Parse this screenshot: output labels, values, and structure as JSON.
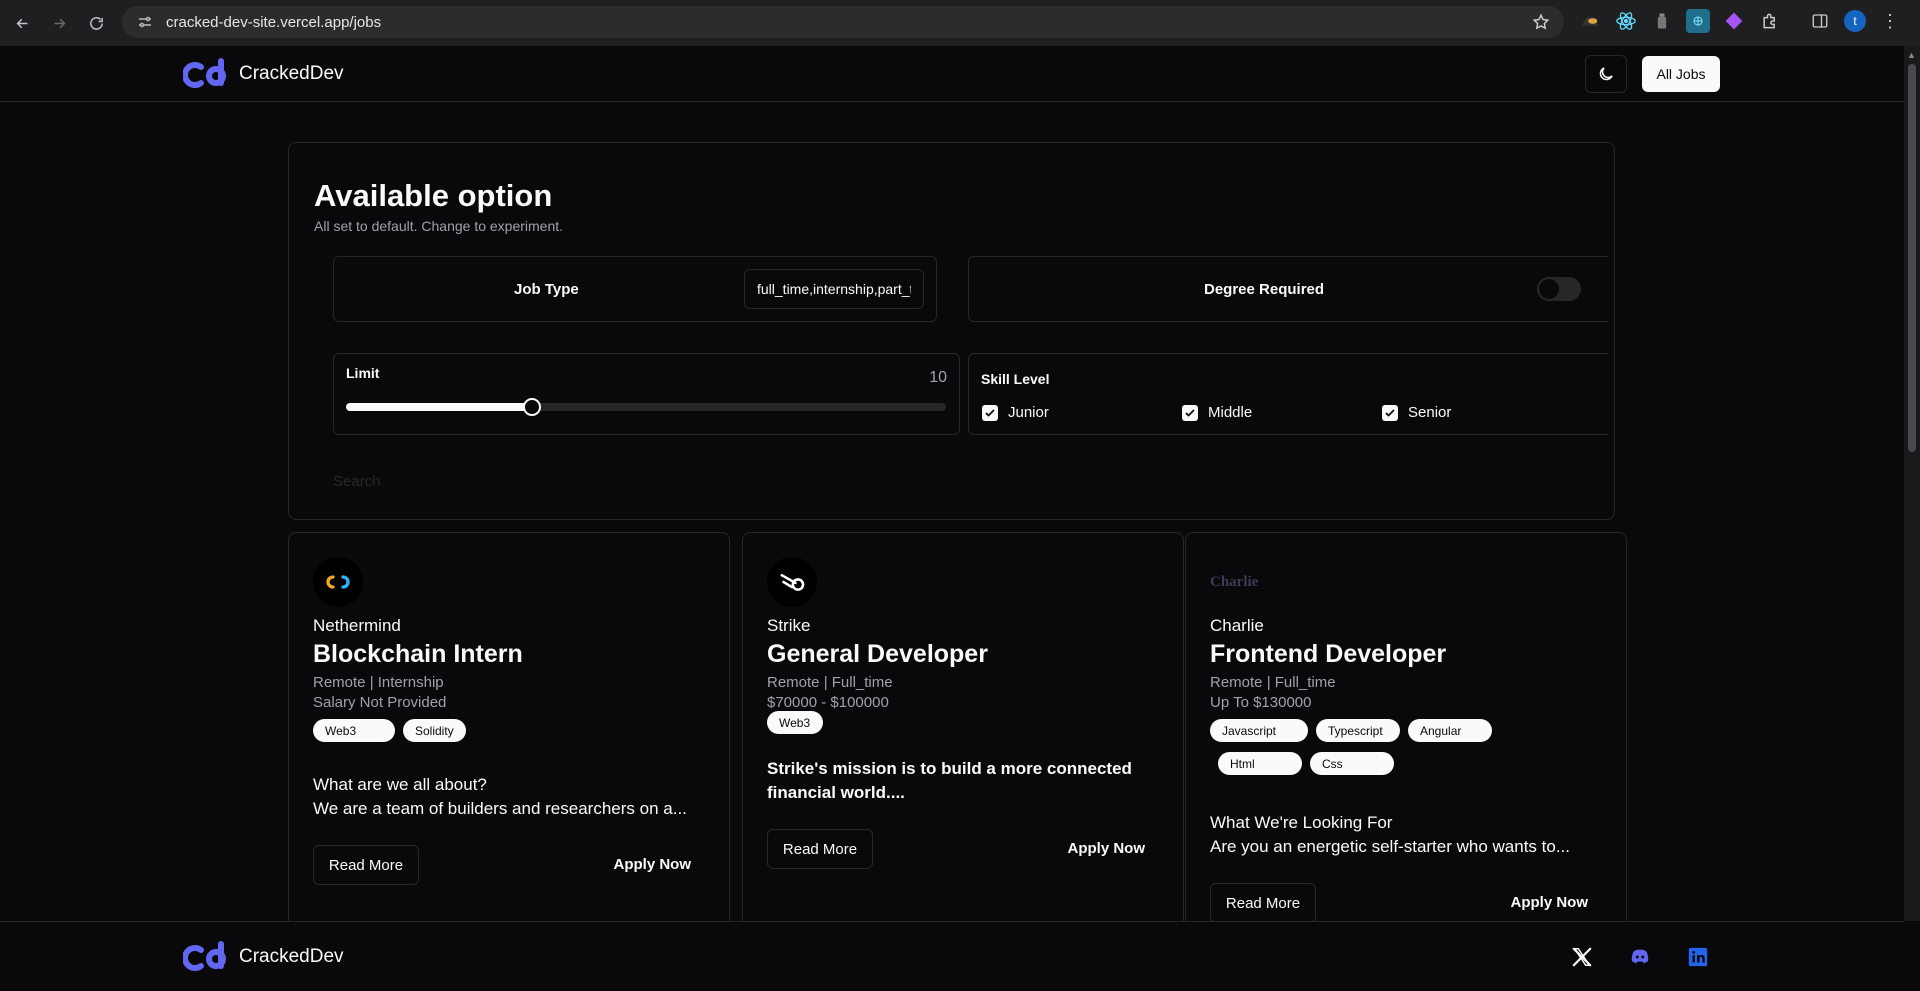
{
  "browser": {
    "url": "cracked-dev-site.vercel.app/jobs",
    "profile_initial": "t"
  },
  "header": {
    "logo_text": "CrackedDev",
    "all_jobs_label": "All Jobs"
  },
  "options": {
    "title": "Available option",
    "subtitle": "All set to default. Change to experiment.",
    "job_type_label": "Job Type",
    "job_type_value": "full_time,internship,part_time",
    "degree_label": "Degree Required",
    "degree_required": false,
    "limit_label": "Limit",
    "limit_value": "10",
    "limit_fraction": 0.31,
    "skill_label": "Skill Level",
    "skills": [
      {
        "label": "Junior",
        "checked": true
      },
      {
        "label": "Middle",
        "checked": true
      },
      {
        "label": "Senior",
        "checked": true
      }
    ],
    "search_placeholder": "Search"
  },
  "jobs": [
    {
      "company": "Nethermind",
      "title": "Blockchain Intern",
      "location_type": "Remote | Internship",
      "salary": "Salary Not Provided",
      "tags": [
        "Web3",
        "Solidity"
      ],
      "desc_heading": "What are we all about?",
      "desc_text": "We are a team of builders and researchers on a...",
      "read_more": "Read More",
      "apply": "Apply Now"
    },
    {
      "company": "Strike",
      "title": "General Developer",
      "location_type": "Remote | Full_time",
      "salary": "$70000 - $100000",
      "tags": [
        "Web3"
      ],
      "desc_bold": "Strike's mission is to build a more connected financial world....",
      "read_more": "Read More",
      "apply": "Apply Now"
    },
    {
      "company": "Charlie",
      "logo_text": "Charlie",
      "title": "Frontend Developer",
      "location_type": "Remote | Full_time",
      "salary": "Up To $130000",
      "tags": [
        "Javascript",
        "Typescript",
        "Angular",
        "Html",
        "Css"
      ],
      "desc_heading": "What We're Looking For",
      "desc_text": "Are you an energetic self-starter who wants to...",
      "read_more": "Read More",
      "apply": "Apply Now"
    }
  ],
  "footer": {
    "logo_text": "CrackedDev",
    "social_icons": [
      "x-icon",
      "discord-icon",
      "linkedin-icon"
    ]
  },
  "colors": {
    "background": "#09090b",
    "border": "#27272a",
    "accent": "#6366f1",
    "muted": "#a1a1aa"
  }
}
